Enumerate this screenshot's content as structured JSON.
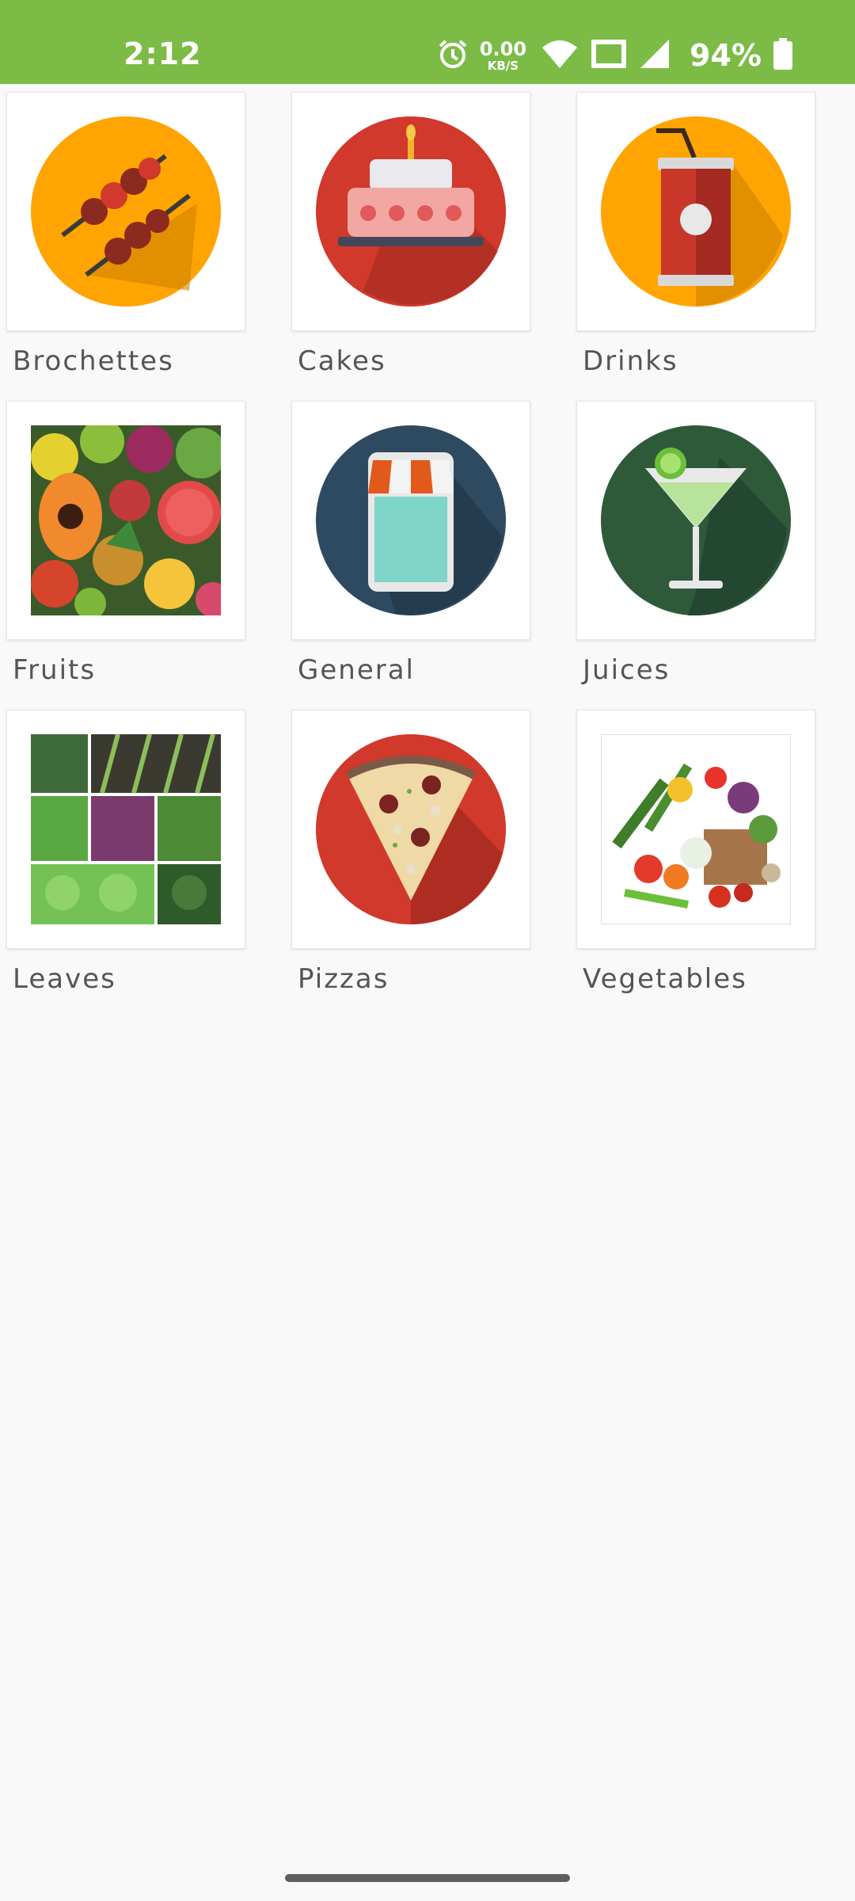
{
  "status_bar": {
    "time": "2:12",
    "net_speed_value": "0.00",
    "net_speed_unit": "KB/S",
    "battery_percent": "94%",
    "icons": [
      "alarm-icon",
      "wifi-icon",
      "vowifi-icon",
      "cell-signal-icon",
      "battery-icon"
    ]
  },
  "categories": [
    {
      "label": "Brochettes",
      "icon": "skewers-icon"
    },
    {
      "label": "Cakes",
      "icon": "cake-icon"
    },
    {
      "label": "Drinks",
      "icon": "soda-can-icon"
    },
    {
      "label": "Fruits",
      "icon": "fruits-photo"
    },
    {
      "label": "General",
      "icon": "store-icon"
    },
    {
      "label": "Juices",
      "icon": "cocktail-icon"
    },
    {
      "label": "Leaves",
      "icon": "leaves-photo"
    },
    {
      "label": "Pizzas",
      "icon": "pizza-slice-icon"
    },
    {
      "label": "Vegetables",
      "icon": "vegetables-photo"
    }
  ],
  "colors": {
    "status_bar": "#7cbc46",
    "background": "#f9f9f9",
    "orange_circle": "#ffa400",
    "red_circle": "#d0392b",
    "navy_circle": "#2e4a60",
    "green_circle": "#2f5a3a"
  }
}
